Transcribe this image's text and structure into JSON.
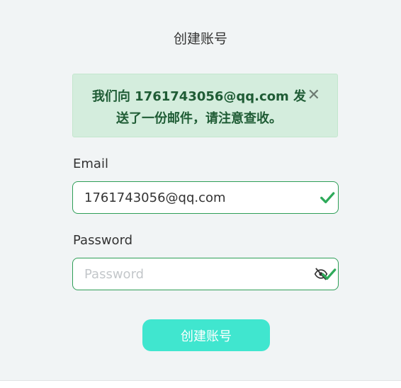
{
  "page": {
    "title": "创建账号"
  },
  "alert": {
    "message": "我们向 1761743056@qq.com 发送了一份邮件，请注意查收。",
    "close_symbol": "✕"
  },
  "form": {
    "email": {
      "label": "Email",
      "value": "1761743056@qq.com",
      "icon": "check-icon"
    },
    "password": {
      "label": "Password",
      "placeholder": "Password",
      "value": "",
      "icons": [
        "eye-slash-icon",
        "check-icon"
      ]
    },
    "submit_label": "创建账号"
  },
  "colors": {
    "background": "#f1f4f5",
    "alert_bg": "#d4eddd",
    "alert_text": "#1f5c35",
    "field_border": "#2e9e57",
    "check": "#2eaa5a",
    "button_bg": "#40e6cf"
  }
}
